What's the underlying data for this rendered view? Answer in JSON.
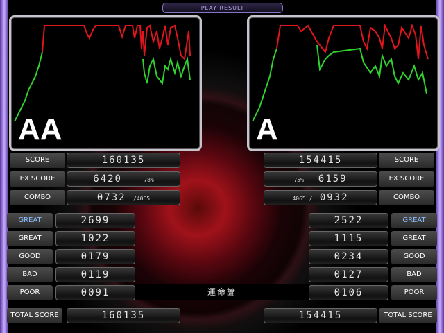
{
  "header": {
    "title": "PLAY RESULT"
  },
  "song_title": "運命論",
  "p1": {
    "grade": "AA",
    "score": "160135",
    "ex_score": "6420",
    "ex_percent": "78%",
    "combo": "0732",
    "combo_total": "/4065",
    "great_top": "2699",
    "great": "1022",
    "good": "0179",
    "bad": "0119",
    "poor": "0091",
    "total_score": "160135"
  },
  "p2": {
    "grade": "A",
    "score": "154415",
    "ex_score": "6159",
    "ex_percent": "75%",
    "combo": "0932",
    "combo_total": "4065 /",
    "great_top": "2522",
    "great": "1115",
    "good": "0234",
    "bad": "0127",
    "poor": "0106",
    "total_score": "154415"
  },
  "labels": {
    "score": "SCORE",
    "ex_score": "EX SCORE",
    "combo": "COMBO",
    "great_top": "GREAT",
    "great": "GREAT",
    "good": "GOOD",
    "bad": "BAD",
    "poor": "POOR",
    "total_score": "TOTAL SCORE"
  },
  "colors": {
    "gauge_red": "#e0161c",
    "gauge_green": "#2fd22f",
    "frame": "#b39be8"
  }
}
